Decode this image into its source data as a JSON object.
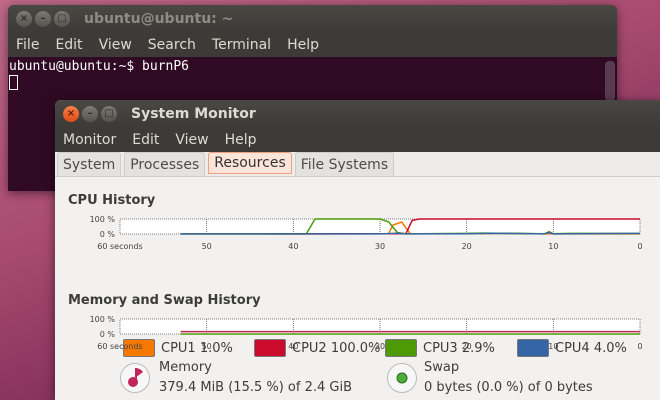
{
  "terminal": {
    "title": "ubuntu@ubuntu: ~",
    "menu": [
      "File",
      "Edit",
      "View",
      "Search",
      "Terminal",
      "Help"
    ],
    "prompt": "ubuntu@ubuntu:~$ burnP6"
  },
  "sysmon": {
    "title": "System Monitor",
    "menu": [
      "Monitor",
      "Edit",
      "View",
      "Help"
    ],
    "tabs": [
      "System",
      "Processes",
      "Resources",
      "File Systems"
    ],
    "active_tab": "Resources",
    "cpu_title": "CPU History",
    "mem_title": "Memory and Swap History",
    "memory": {
      "label": "Memory",
      "value": "379.4 MiB (15.5 %) of 2.4 GiB",
      "color": "#c0265a"
    },
    "swap": {
      "label": "Swap",
      "value": "0 bytes (0.0 %) of 0 bytes",
      "color": "#4caf3c"
    }
  },
  "chart_data": [
    {
      "type": "line",
      "title": "CPU History",
      "y_ticks": [
        "100 %",
        "0 %"
      ],
      "x_ticks": [
        "60 seconds",
        "50",
        "40",
        "30",
        "20",
        "10",
        "0"
      ],
      "xlim": [
        60,
        0
      ],
      "ylim": [
        0,
        100
      ],
      "series": [
        {
          "name": "CPU1",
          "label": "CPU1  1.0%",
          "color": "#f57900",
          "points": [
            [
              53,
              1
            ],
            [
              40,
              1
            ],
            [
              29,
              2
            ],
            [
              28.5,
              60
            ],
            [
              27.5,
              80
            ],
            [
              27,
              40
            ],
            [
              26.5,
              2
            ],
            [
              20,
              2
            ],
            [
              18,
              4
            ],
            [
              10,
              1
            ],
            [
              0,
              1
            ]
          ]
        },
        {
          "name": "CPU2",
          "label": "CPU2  100.0%",
          "color": "#cc0a2c",
          "points": [
            [
              53,
              2
            ],
            [
              40,
              1
            ],
            [
              28,
              2
            ],
            [
              27,
              3
            ],
            [
              26.3,
              90
            ],
            [
              25.5,
              100
            ],
            [
              0,
              100
            ]
          ]
        },
        {
          "name": "CPU3",
          "label": "CPU3  2.9%",
          "color": "#4e9a06",
          "points": [
            [
              53,
              1
            ],
            [
              38.5,
              1
            ],
            [
              37.5,
              100
            ],
            [
              30,
              100
            ],
            [
              29,
              80
            ],
            [
              28,
              10
            ],
            [
              27,
              1
            ],
            [
              20,
              4
            ],
            [
              18,
              6
            ],
            [
              11,
              2
            ],
            [
              10.5,
              15
            ],
            [
              10,
              2
            ],
            [
              8,
              4
            ],
            [
              0,
              3
            ]
          ]
        },
        {
          "name": "CPU4",
          "label": "CPU4  4.0%",
          "color": "#3465a4",
          "points": [
            [
              53,
              1
            ],
            [
              30,
              1
            ],
            [
              28,
              5
            ],
            [
              27,
              1
            ],
            [
              20,
              2
            ],
            [
              17,
              5
            ],
            [
              11,
              1
            ],
            [
              10.5,
              10
            ],
            [
              10,
              1
            ],
            [
              0,
              4
            ]
          ]
        }
      ]
    },
    {
      "type": "line",
      "title": "Memory and Swap History",
      "y_ticks": [
        "100 %",
        "0 %"
      ],
      "x_ticks": [
        "60 seconds",
        "50",
        "40",
        "30",
        "20",
        "10",
        "0"
      ],
      "xlim": [
        60,
        0
      ],
      "ylim": [
        0,
        100
      ],
      "series": [
        {
          "name": "Memory",
          "color": "#c0265a",
          "points": [
            [
              53,
              15.5
            ],
            [
              0,
              15.5
            ]
          ]
        },
        {
          "name": "Swap",
          "color": "#4e9a06",
          "points": [
            [
              53,
              0
            ],
            [
              0,
              0
            ]
          ]
        }
      ]
    }
  ]
}
